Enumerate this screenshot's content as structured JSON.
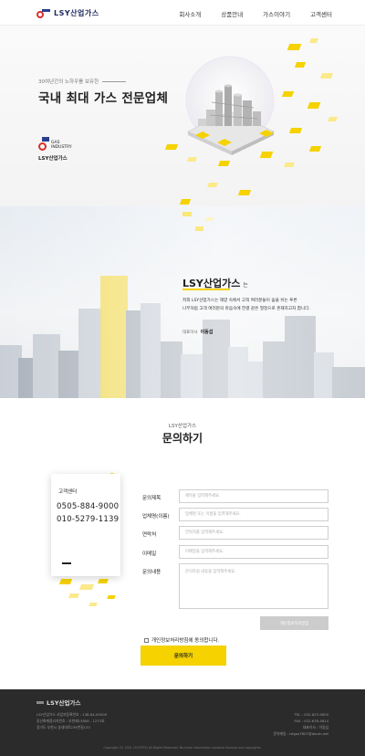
{
  "nav": {
    "logo_text": "LSY산업가스",
    "menu": [
      "회사소개",
      "상품안내",
      "가스이야기",
      "고객센터"
    ]
  },
  "hero": {
    "subtitle": "30여년간의 노하우를 보유한",
    "title": "국내 최대 가스 전문업체",
    "logo_gas": "GAS",
    "logo_industry": "INDUSTRY",
    "logo_name": "LSY산업가스"
  },
  "about": {
    "heading": "LSY산업가스",
    "heading_suffix": "는",
    "line1": "저희 LSY산업가스는 해양 속에서 고객 여러분들이 숨을 쉬는 푸른",
    "line2": "나무처럼 고객 여러분의 마음속에 한결 같은 열정으로 존재하고자 합니다.",
    "ceo_label": "대표이사",
    "ceo_name": "이동섭"
  },
  "inquiry": {
    "subtitle": "LSY산업가스",
    "title": "문의하기",
    "card_label": "고객센터",
    "phone1": "0505-884-9000",
    "phone2": "010-5279-1139",
    "fields": [
      {
        "label": "문의제목",
        "placeholder": "제목을 입력해주세요."
      },
      {
        "label": "업체명(이름)",
        "placeholder": "업체명 또는 이름을 입력해주세요."
      },
      {
        "label": "연락처",
        "placeholder": "연락처를 입력해주세요."
      },
      {
        "label": "이메일",
        "placeholder": "이메일을 입력해주세요."
      },
      {
        "label": "문의내용",
        "placeholder": "문의하실 내용을 입력해주세요."
      }
    ],
    "privacy_button": "개인정보처리방침",
    "agree_label": "개인정보처리방침에 동의합니다.",
    "submit": "문의하기"
  },
  "footer": {
    "logo_text": "LSY산업가스",
    "info1": "LSY산업가스  사업자등록번호 : 138-84-00509",
    "info2": "동산화재정리지번호 : 부천제13808 - 1273호",
    "info3": "경기도 부천시 송내대로239번길133",
    "tel": "TEL : 032-623-9000",
    "fax": "FAX : 032-678-4814",
    "ceo": "대표이사 : 이동섭",
    "email": "문의메일 : lsfgas7807@daum.net",
    "copyright": "Copyright (C) 2021 LSY(ITEX) All Rights Reserved. No more information contacts Homme and copyrights."
  }
}
